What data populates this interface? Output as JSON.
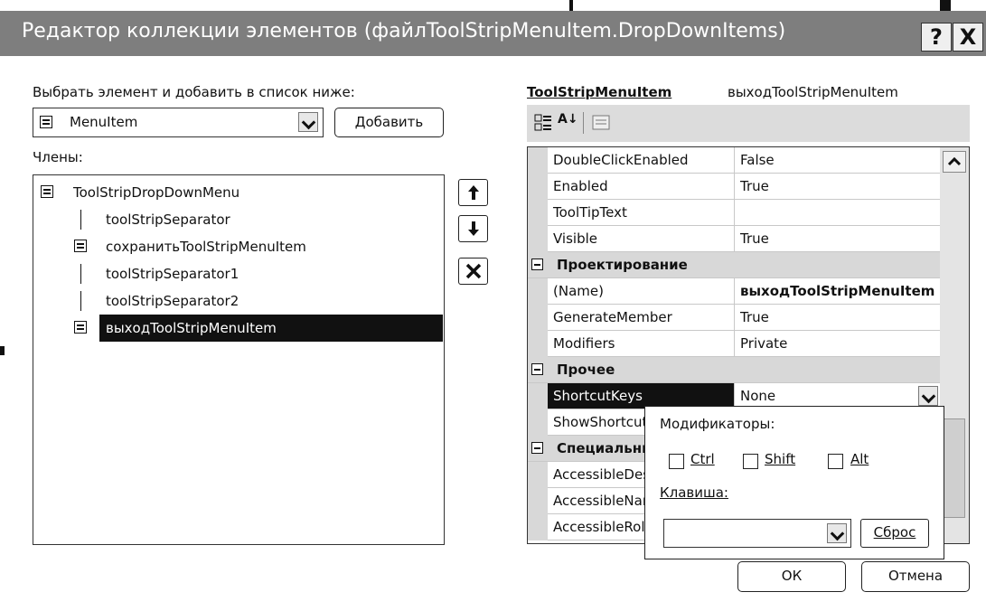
{
  "window": {
    "title": "Редактор коллекции элементов (файлToolStripMenuItem.DropDownItems)",
    "help_glyph": "?",
    "close_glyph": "X"
  },
  "left": {
    "select_label": "Выбрать элемент и добавить в список ниже:",
    "type_combo_value": "MenuItem",
    "add_button": "Добавить",
    "members_label": "Члены:",
    "members": [
      {
        "text": "ToolStripDropDownMenu",
        "icon": "dropdown-menu-icon",
        "selected": false
      },
      {
        "text": "toolStripSeparator",
        "icon": "separator-icon",
        "selected": false
      },
      {
        "text": "сохранитьToolStripMenuItem",
        "icon": "menu-item-icon",
        "selected": false
      },
      {
        "text": "toolStripSeparator1",
        "icon": "separator-icon",
        "selected": false
      },
      {
        "text": "toolStripSeparator2",
        "icon": "separator-icon",
        "selected": false
      },
      {
        "text": "выходToolStripMenuItem",
        "icon": "menu-item-icon",
        "selected": true
      }
    ],
    "move_up_glyph": "🡅",
    "move_down_glyph": "🡇",
    "remove_glyph": "✕"
  },
  "right": {
    "object_type": "ToolStripMenuItem",
    "object_name": "выходToolStripMenuItem",
    "toolbar": {
      "categorized_icon": "categorized-icon",
      "alphabetical_icon": "alphabetical-icon",
      "alphabetical_glyph": "A↓",
      "property_pages_icon": "property-pages-icon"
    },
    "properties": {
      "r0": {
        "name": "DoubleClickEnabled",
        "value": "False"
      },
      "r1": {
        "name": "Enabled",
        "value": "True"
      },
      "r2": {
        "name": "ToolTipText",
        "value": ""
      },
      "r3": {
        "name": "Visible",
        "value": "True"
      },
      "c4": {
        "name": "Проектирование"
      },
      "r5": {
        "name": "(Name)",
        "value": "выходToolStripMenuItem"
      },
      "r6": {
        "name": "GenerateMember",
        "value": "True"
      },
      "r7": {
        "name": "Modifiers",
        "value": "Private"
      },
      "c8": {
        "name": "Прочее"
      },
      "r9": {
        "name": "ShortcutKeys",
        "value": "None"
      },
      "r10": {
        "name": "ShowShortcutKeys",
        "value": ""
      },
      "c11": {
        "name": "Специальные"
      },
      "r12": {
        "name": "AccessibleDescription",
        "value": ""
      },
      "r13": {
        "name": "AccessibleName",
        "value": ""
      },
      "r14": {
        "name": "AccessibleRole",
        "value": ""
      }
    }
  },
  "shortcut_popup": {
    "modifiers_label": "Модификаторы:",
    "ctrl": {
      "label": "Ctrl",
      "checked": false
    },
    "shift": {
      "label": "Shift",
      "checked": false
    },
    "alt": {
      "label": "Alt",
      "checked": false
    },
    "key_label": "Клавиша:",
    "key_value": "",
    "reset_button": "Сброс"
  },
  "buttons": {
    "ok": "ОК",
    "cancel": "Отмена"
  }
}
